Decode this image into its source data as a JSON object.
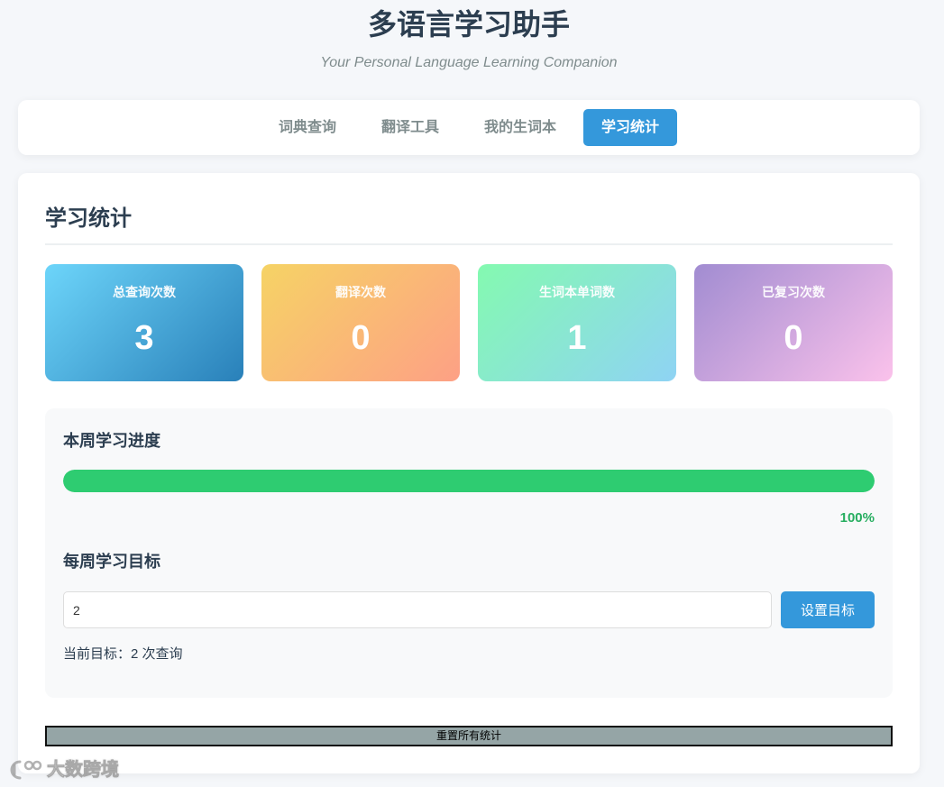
{
  "app": {
    "title": "多语言学习助手",
    "subtitle": "Your Personal Language Learning Companion"
  },
  "nav": {
    "tabs": [
      {
        "label": "词典查询",
        "active": false
      },
      {
        "label": "翻译工具",
        "active": false
      },
      {
        "label": "我的生词本",
        "active": false
      },
      {
        "label": "学习统计",
        "active": true
      }
    ]
  },
  "stats": {
    "heading": "学习统计",
    "cards": [
      {
        "label": "总查询次数",
        "value": "3",
        "gradient": [
          "#6dd5fa",
          "#2980b9"
        ]
      },
      {
        "label": "翻译次数",
        "value": "0",
        "gradient": [
          "#f6d365",
          "#fda085"
        ]
      },
      {
        "label": "生词本单词数",
        "value": "1",
        "gradient": [
          "#84fab0",
          "#8fd3f4"
        ]
      },
      {
        "label": "已复习次数",
        "value": "0",
        "gradient": [
          "#a18cd1",
          "#fbc2eb"
        ]
      }
    ]
  },
  "weekly_progress": {
    "heading": "本周学习进度",
    "percent": 100,
    "percent_label": "100%",
    "fill_color": "#2ecc71"
  },
  "weekly_goal": {
    "heading": "每周学习目标",
    "input_value": "2",
    "button_label": "设置目标",
    "current_goal_text": "当前目标：2 次查询"
  },
  "reset": {
    "label": "重置所有统计"
  },
  "watermark": {
    "text": "大数跨境",
    "logo_icon": "brand-logo-icon"
  },
  "colors": {
    "accent": "#3498db",
    "title": "#2c3e50",
    "percent_text": "#27ae60",
    "reset_button": "#95a5a6"
  }
}
